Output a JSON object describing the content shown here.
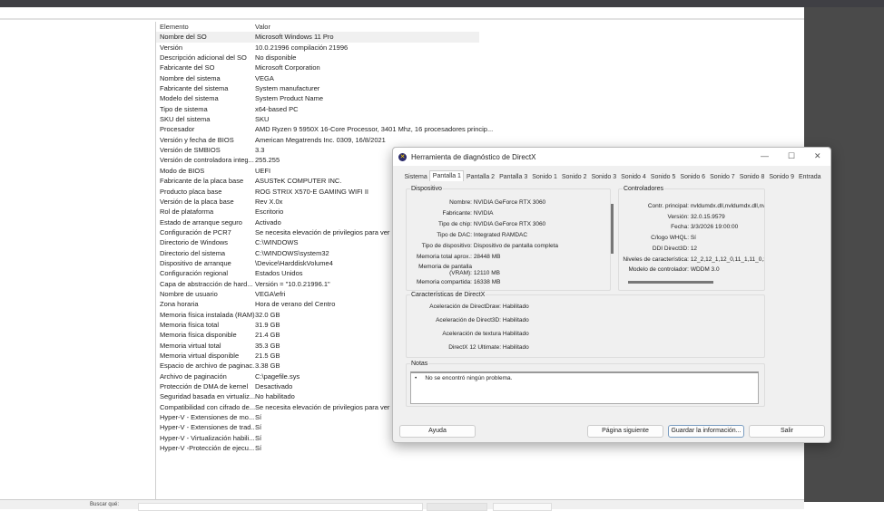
{
  "msinfo": {
    "columns": [
      "Elemento",
      "Valor"
    ],
    "rows": [
      [
        "Nombre del SO",
        "Microsoft Windows 11 Pro"
      ],
      [
        "Versión",
        "10.0.21996 compilación 21996"
      ],
      [
        "Descripción adicional del SO",
        "No disponible"
      ],
      [
        "Fabricante del SO",
        "Microsoft Corporation"
      ],
      [
        "Nombre del sistema",
        "VEGA"
      ],
      [
        "Fabricante del sistema",
        "System manufacturer"
      ],
      [
        "Modelo del sistema",
        "System Product Name"
      ],
      [
        "Tipo de sistema",
        "x64-based PC"
      ],
      [
        "SKU del sistema",
        "SKU"
      ],
      [
        "Procesador",
        "AMD Ryzen 9 5950X 16-Core Processor, 3401 Mhz, 16 procesadores princip..."
      ],
      [
        "Versión y fecha de BIOS",
        "American Megatrends Inc. 0309, 16/8/2021"
      ],
      [
        "Versión de SMBIOS",
        "3.3"
      ],
      [
        "Versión de controladora integ...",
        "255.255"
      ],
      [
        "Modo de BIOS",
        "UEFI"
      ],
      [
        "Fabricante de la placa base",
        "ASUSTeK COMPUTER INC."
      ],
      [
        "Producto placa base",
        "ROG STRIX X570-E GAMING WIFI II"
      ],
      [
        "Versión de la placa base",
        "Rev X.0x"
      ],
      [
        "Rol de plataforma",
        "Escritorio"
      ],
      [
        "Estado de arranque seguro",
        "Activado"
      ],
      [
        "Configuración de PCR7",
        "Se necesita elevación de privilegios para ver"
      ],
      [
        "Directorio de Windows",
        "C:\\WINDOWS"
      ],
      [
        "Directorio del sistema",
        "C:\\WINDOWS\\system32"
      ],
      [
        "Dispositivo de arranque",
        "\\Device\\HarddiskVolume4"
      ],
      [
        "Configuración regional",
        "Estados Unidos"
      ],
      [
        "Capa de abstracción de hard...",
        "Versión = \"10.0.21996.1\""
      ],
      [
        "Nombre de usuario",
        "VEGA\\efri"
      ],
      [
        "Zona horaria",
        "Hora de verano del Centro"
      ],
      [
        "Memoria física instalada (RAM)",
        "32.0 GB"
      ],
      [
        "Memoria física total",
        "31.9 GB"
      ],
      [
        "Memoria física disponible",
        "21.4 GB"
      ],
      [
        "Memoria virtual total",
        "35.3 GB"
      ],
      [
        "Memoria virtual disponible",
        "21.5 GB"
      ],
      [
        "Espacio de archivo de paginac...",
        "3.38 GB"
      ],
      [
        "Archivo de paginación",
        "C:\\pagefile.sys"
      ],
      [
        "Protección de DMA de kernel",
        "Desactivado"
      ],
      [
        "Seguridad basada en virtualiz...",
        "No habilitado"
      ],
      [
        "Compatibilidad con cifrado de...",
        "Se necesita elevación de privilegios para ver"
      ],
      [
        "Hyper-V - Extensiones de mo...",
        "Sí"
      ],
      [
        "Hyper-V - Extensiones de trad...",
        "Sí"
      ],
      [
        "Hyper-V - Virtualización habili...",
        "Sí"
      ],
      [
        "Hyper-V -Protección de ejecu...",
        "Sí"
      ]
    ],
    "find_label": "Buscar qué:"
  },
  "dxdiag": {
    "title": "Herramienta de diagnóstico de DirectX",
    "tabs": [
      "Sistema",
      "Pantalla 1",
      "Pantalla 2",
      "Pantalla 3",
      "Sonido 1",
      "Sonido 2",
      "Sonido 3",
      "Sonido 4",
      "Sonido 5",
      "Sonido 6",
      "Sonido 7",
      "Sonido 8",
      "Sonido 9",
      "Entrada"
    ],
    "active_tab": "Pantalla 1",
    "device": {
      "label": "Dispositivo",
      "items": [
        [
          "Nombre:",
          "NVIDIA GeForce RTX 3060"
        ],
        [
          "Fabricante:",
          "NVIDIA"
        ],
        [
          "Tipo de chip:",
          "NVIDIA GeForce RTX 3060"
        ],
        [
          "Tipo de DAC:",
          "Integrated RAMDAC"
        ],
        [
          "Tipo de dispositivo:",
          "Dispositivo de pantalla completa"
        ],
        [
          "Memoria total aprox.:",
          "28448 MB"
        ],
        [
          "Memoria de pantalla (VRAM):",
          "12110 MB"
        ],
        [
          "Memoria compartida:",
          "16338 MB"
        ]
      ]
    },
    "drivers": {
      "label": "Controladores",
      "items": [
        [
          "Contr. principal:",
          "nvldumdx.dll,nvldumdx.dll,nv"
        ],
        [
          "Versión:",
          "32.0.15.9579"
        ],
        [
          "Fecha:",
          "3/3/2026 19:00:00"
        ],
        [
          "C/logo WHQL:",
          "Sí"
        ],
        [
          "DDI Direct3D:",
          "12"
        ],
        [
          "Niveles de característica:",
          "12_2,12_1,12_0,11_1,11_0,:"
        ],
        [
          "Modelo de controlador:",
          "WDDM 3.0"
        ]
      ]
    },
    "features": {
      "label": "Características de DirectX",
      "items": [
        [
          "Aceleración de DirectDraw:",
          "Habilitado"
        ],
        [
          "Aceleración de Direct3D:",
          "Habilitado"
        ],
        [
          "Aceleración de textura",
          "Habilitado"
        ],
        [
          "DirectX 12 Ultimate:",
          "Habilitado"
        ]
      ]
    },
    "notes": {
      "label": "Notas",
      "text": "No se encontró ningún problema."
    },
    "buttons": {
      "help": "Ayuda",
      "next": "Página siguiente",
      "save": "Guardar la información...",
      "exit": "Salir"
    }
  }
}
